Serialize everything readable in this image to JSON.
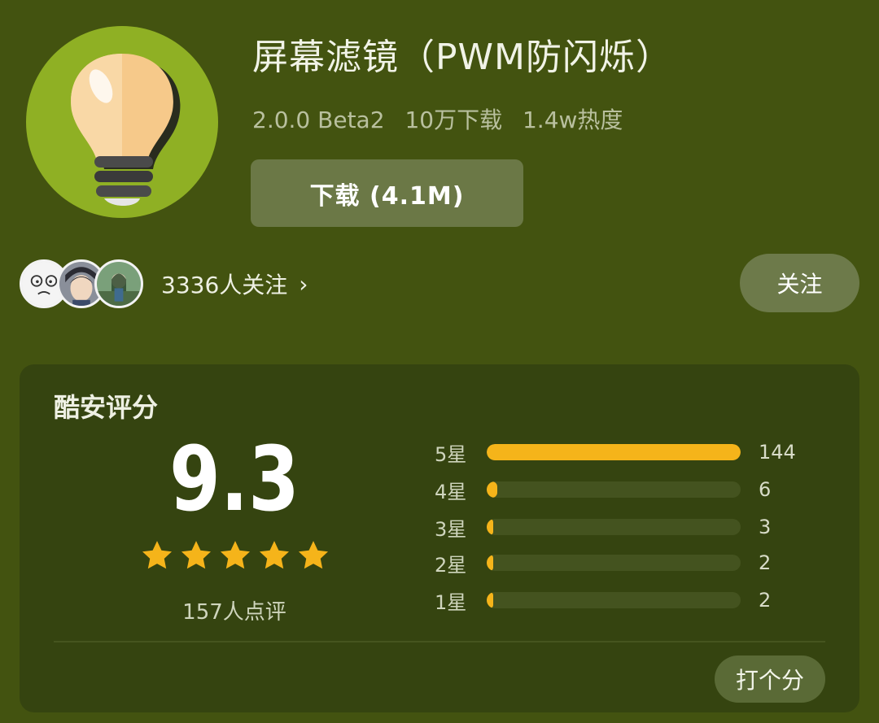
{
  "app": {
    "title": "屏幕滤镜（PWM防闪烁）",
    "version": "2.0.0 Beta2",
    "downloads": "10万下载",
    "heat": "1.4w热度",
    "download_label": "下载 (4.1M)",
    "icon": "lightbulb-icon"
  },
  "social": {
    "followers_text": "3336人关注",
    "follow_label": "关注",
    "avatars": [
      "avatar-meme",
      "avatar-anime-boy",
      "avatar-anime-girl"
    ]
  },
  "rating": {
    "title": "酷安评分",
    "score": "9.3",
    "stars": 5,
    "review_count": "157人点评",
    "rate_label": "打个分",
    "distribution": [
      {
        "label": "5星",
        "count": 144
      },
      {
        "label": "4星",
        "count": 6
      },
      {
        "label": "3星",
        "count": 3
      },
      {
        "label": "2星",
        "count": 2
      },
      {
        "label": "1星",
        "count": 2
      }
    ]
  },
  "colors": {
    "background": "#435310",
    "card": "#354410",
    "accent": "#f5b41a",
    "icon_circle": "#8fb024"
  }
}
